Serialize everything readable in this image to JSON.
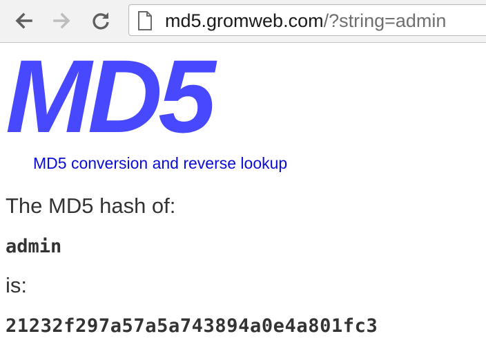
{
  "browser": {
    "url_host": "md5.gromweb.com",
    "url_path": "/?string=admin",
    "icons": {
      "back": "back-arrow-icon",
      "forward": "forward-arrow-icon",
      "reload": "reload-icon",
      "page": "page-icon"
    }
  },
  "page": {
    "logo": "MD5",
    "tagline": "MD5 conversion and reverse lookup",
    "hash_of_label": "The MD5 hash of:",
    "input_string": "admin",
    "is_label": "is:",
    "hash_value": "21232f297a57a5a743894a0e4a801fc3"
  },
  "colors": {
    "logo": "#4848ff",
    "tagline": "#0b0bd8",
    "text": "#333333"
  }
}
